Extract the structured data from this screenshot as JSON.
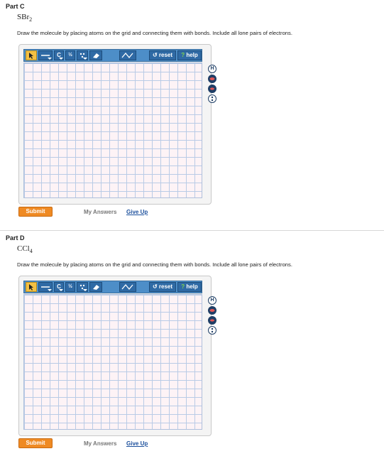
{
  "parts": [
    {
      "title": "Part C",
      "formula_base": "SBr",
      "formula_sub": "2",
      "instruction": "Draw the molecule by placing atoms on the grid and connecting them with bonds. Include all lone pairs of electrons.",
      "toolbar": {
        "atom_label": "C",
        "charge_label": "½",
        "reset_label": "reset",
        "help_label": "help"
      },
      "side_tools": [
        "H"
      ],
      "submit_label": "Submit",
      "my_answers_label": "My Answers",
      "give_up_label": "Give Up"
    },
    {
      "title": "Part D",
      "formula_base": "CCl",
      "formula_sub": "4",
      "instruction": "Draw the molecule by placing atoms on the grid and connecting them with bonds. Include all lone pairs of electrons.",
      "toolbar": {
        "atom_label": "C",
        "charge_label": "½",
        "reset_label": "reset",
        "help_label": "help"
      },
      "side_tools": [
        "H"
      ],
      "submit_label": "Submit",
      "my_answers_label": "My Answers",
      "give_up_label": "Give Up"
    }
  ],
  "colors": {
    "toolbar_blue": "#4d8ec8",
    "select_tool_yellow": "#f3c043",
    "submit_orange": "#ef8a23",
    "grid_pink": "#fdf3f6",
    "link_blue": "#1b4f9c"
  }
}
